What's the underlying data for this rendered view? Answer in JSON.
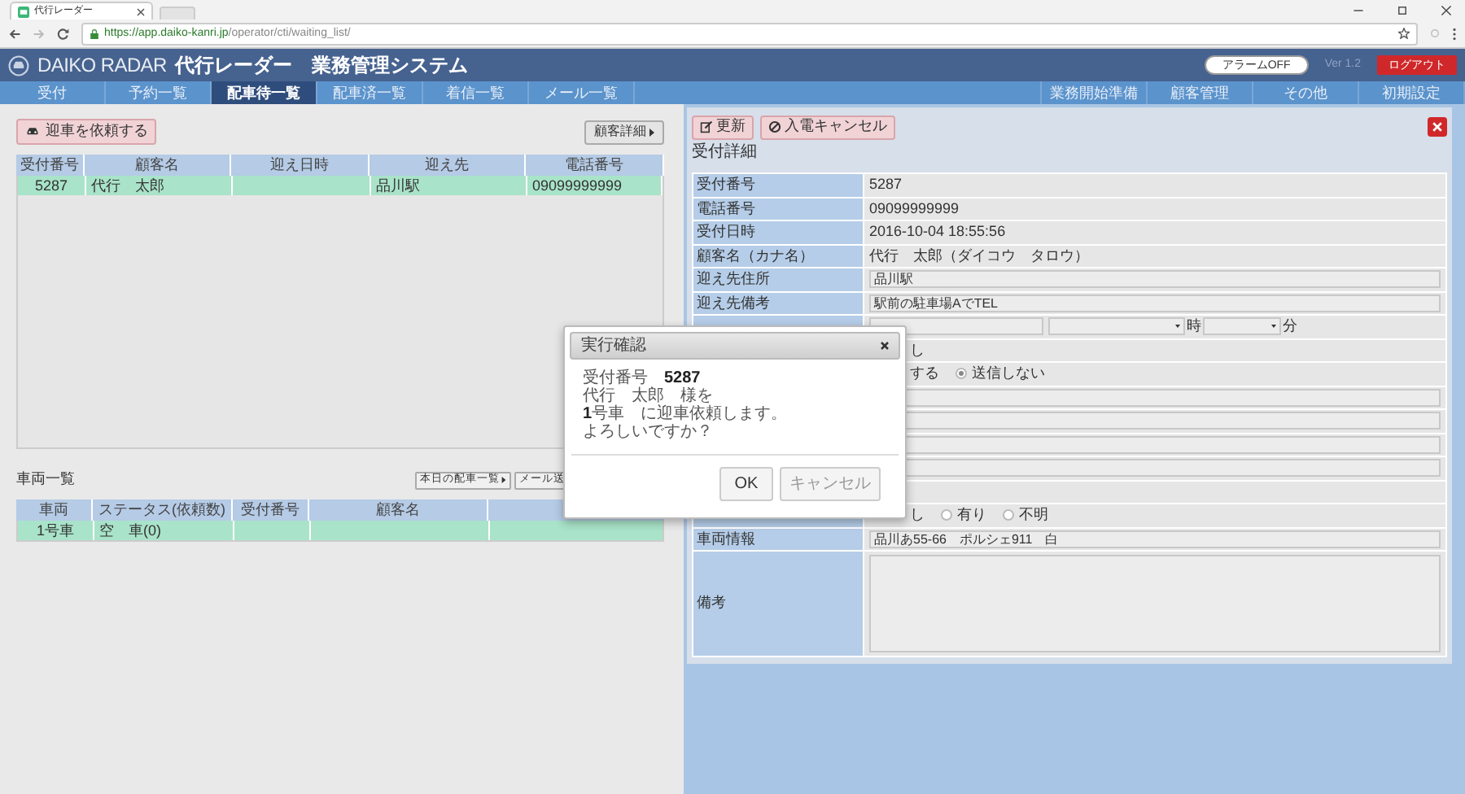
{
  "browser": {
    "tab_title": "代行レーダー",
    "url_host": "https://app.daiko-kanri.jp",
    "url_path": "/operator/cti/waiting_list/"
  },
  "header": {
    "logo": "DAIKO RADAR",
    "title": "代行レーダー　業務管理システム",
    "alarm_button": "アラームOFF",
    "version": "Ver 1.2",
    "logout_button": "ログアウト"
  },
  "nav": {
    "left": [
      {
        "label": "受付",
        "selected": false
      },
      {
        "label": "予約一覧",
        "selected": false
      },
      {
        "label": "配車待一覧",
        "selected": true
      },
      {
        "label": "配車済一覧",
        "selected": false
      },
      {
        "label": "着信一覧",
        "selected": false
      },
      {
        "label": "メール一覧",
        "selected": false
      }
    ],
    "right": [
      {
        "label": "業務開始準備",
        "selected": false
      },
      {
        "label": "顧客管理",
        "selected": false
      },
      {
        "label": "その他",
        "selected": false
      },
      {
        "label": "初期設定",
        "selected": false
      }
    ]
  },
  "reception_list": {
    "request_button": "迎車を依頼する",
    "detail_button": "顧客詳細",
    "columns": [
      "受付番号",
      "顧客名",
      "迎え日時",
      "迎え先",
      "電話番号"
    ],
    "rows": [
      {
        "cells": [
          "5287",
          "代行　太郎",
          "",
          "品川駅",
          "09099999999"
        ],
        "selected": true
      }
    ]
  },
  "vehicle_list": {
    "title": "車両一覧",
    "buttons": [
      "本日の配車一覧",
      "メール送"
    ],
    "columns": [
      "車両",
      "ステータス(依頼数)",
      "受付番号",
      "顧客名"
    ],
    "rows": [
      {
        "cells": [
          "1号車",
          "空　車(0)",
          "",
          ""
        ],
        "selected": true
      }
    ]
  },
  "detail": {
    "buttons": [
      "更新",
      "入電キャンセル"
    ],
    "title": "受付詳細",
    "fields": [
      {
        "kind": "text",
        "label": "受付番号",
        "value": "5287"
      },
      {
        "kind": "text",
        "label": "電話番号",
        "value": "09099999999"
      },
      {
        "kind": "text",
        "label": "受付日時",
        "value": "2016-10-04 18:55:56"
      },
      {
        "kind": "text",
        "label": "顧客名（カナ名）",
        "value": "代行　太郎（ダイコウ　タロウ）"
      },
      {
        "kind": "input",
        "label": "迎え先住所",
        "value": "品川駅"
      },
      {
        "kind": "input",
        "label": "迎え先備考",
        "value": "駅前の駐車場AでTEL"
      },
      {
        "kind": "time",
        "hour_unit": "時",
        "minute_unit": "分"
      },
      {
        "kind": "radios",
        "options": [
          {
            "label": "し"
          }
        ]
      },
      {
        "kind": "radios",
        "options": [
          {
            "label": "する"
          },
          {
            "label": "送信しない",
            "selected": true
          }
        ]
      },
      {
        "kind": "input"
      },
      {
        "kind": "input"
      },
      {
        "kind": "input"
      },
      {
        "kind": "input"
      },
      {
        "kind": "blank"
      },
      {
        "kind": "radios",
        "options": [
          {
            "label": "し"
          },
          {
            "label": "有り",
            "selected": false
          },
          {
            "label": "不明",
            "selected": false
          }
        ]
      },
      {
        "kind": "input",
        "label": "車両情報",
        "value": "品川あ55-66　ポルシェ911　白"
      },
      {
        "kind": "textarea",
        "label": "備考"
      }
    ]
  },
  "dialog": {
    "title": "実行確認",
    "lines": [
      "受付番号　**5287**",
      "代行　太郎　様を",
      "**1**号車　に迎車依頼します。",
      "よろしいですか？"
    ],
    "buttons": [
      "OK",
      "キャンセル"
    ]
  }
}
